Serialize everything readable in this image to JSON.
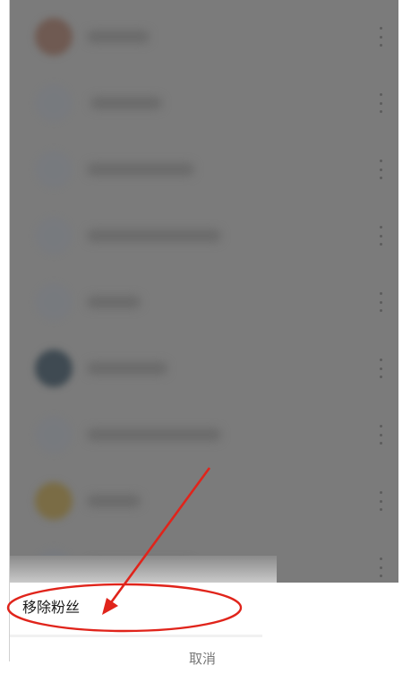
{
  "followers_list": {
    "rows": [
      {
        "avatar": "brown",
        "name_width": 70
      },
      {
        "avatar": "placeholder",
        "name_width": 80
      },
      {
        "avatar": "placeholder",
        "name_width": 120
      },
      {
        "avatar": "placeholder",
        "name_width": 150
      },
      {
        "avatar": "placeholder",
        "name_width": 60
      },
      {
        "avatar": "dark",
        "name_width": 90
      },
      {
        "avatar": "placeholder",
        "name_width": 150
      },
      {
        "avatar": "olive",
        "name_width": 60
      },
      {
        "avatar": "placeholder",
        "name_width": 120
      }
    ]
  },
  "action_sheet": {
    "remove_fan_label": "移除粉丝",
    "cancel_label": "取消"
  },
  "annotation": {
    "color": "#e0241b",
    "icon": "red-arrow-and-ellipse-highlight"
  }
}
